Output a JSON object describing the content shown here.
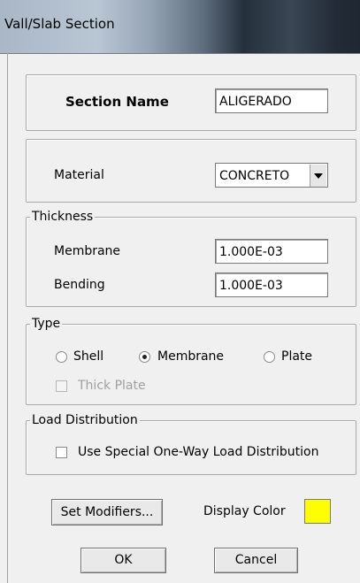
{
  "window": {
    "title": "Vall/Slab Section"
  },
  "section_name": {
    "label": "Section Name",
    "value": "ALIGERADO"
  },
  "material": {
    "label": "Material",
    "selected": "CONCRETO"
  },
  "thickness": {
    "legend": "Thickness",
    "membrane_label": "Membrane",
    "membrane_value": "1.000E-03",
    "bending_label": "Bending",
    "bending_value": "1.000E-03"
  },
  "type": {
    "legend": "Type",
    "options": [
      "Shell",
      "Membrane",
      "Plate"
    ],
    "selected": "Membrane",
    "thick_plate_label": "Thick Plate",
    "thick_plate_checked": false,
    "thick_plate_enabled": false
  },
  "load_distribution": {
    "legend": "Load Distribution",
    "checkbox_label": "Use Special One-Way Load Distribution",
    "checked": false
  },
  "buttons": {
    "set_modifiers": "Set Modifiers...",
    "ok": "OK",
    "cancel": "Cancel"
  },
  "display_color": {
    "label": "Display Color",
    "color": "#ffff00"
  }
}
